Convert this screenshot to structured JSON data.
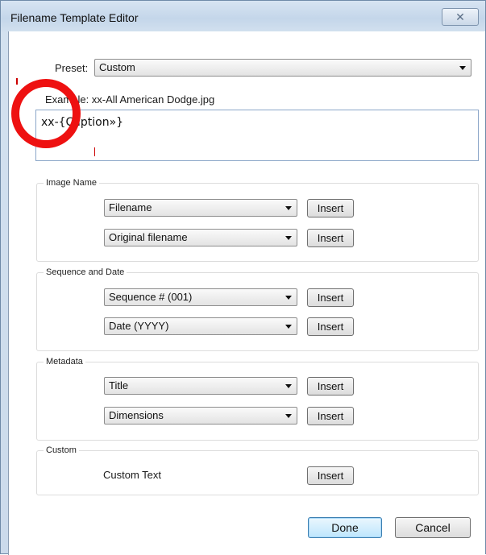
{
  "window": {
    "title": "Filename Template Editor",
    "close_glyph": "✕"
  },
  "preset": {
    "label": "Preset:",
    "value": "Custom"
  },
  "example": {
    "label": "Example: xx-All American Dodge.jpg"
  },
  "template": {
    "value": "xx-{Caption»}"
  },
  "groups": [
    {
      "title": "Image Name",
      "rows": [
        {
          "select": "Filename",
          "button": "Insert"
        },
        {
          "select": "Original filename",
          "button": "Insert"
        }
      ]
    },
    {
      "title": "Sequence and Date",
      "rows": [
        {
          "select": "Sequence # (001)",
          "button": "Insert"
        },
        {
          "select": "Date (YYYY)",
          "button": "Insert"
        }
      ]
    },
    {
      "title": "Metadata",
      "rows": [
        {
          "select": "Title",
          "button": "Insert"
        },
        {
          "select": "Dimensions",
          "button": "Insert"
        }
      ]
    },
    {
      "title": "Custom",
      "rows": [
        {
          "label": "Custom Text",
          "button": "Insert"
        }
      ]
    }
  ],
  "footer": {
    "done": "Done",
    "cancel": "Cancel"
  },
  "colors": {
    "annotation": "#ee1111",
    "titlebar": "#c4d6ea"
  },
  "icons": [
    "close-icon",
    "dropdown-arrow-icon"
  ]
}
